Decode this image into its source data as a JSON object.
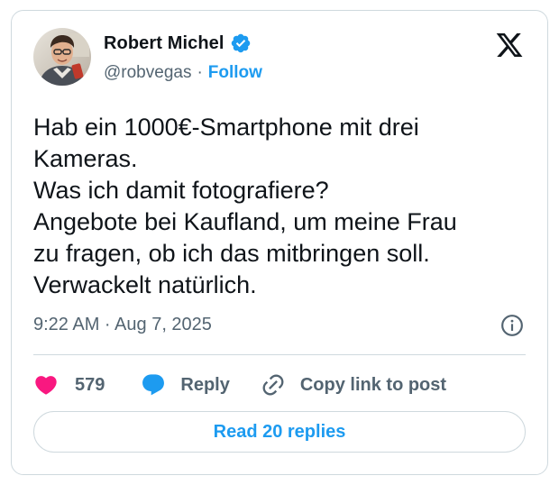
{
  "author": {
    "display_name": "Robert Michel",
    "handle": "@robvegas",
    "separator": "·",
    "follow_label": "Follow",
    "verified_icon": "verified-badge-icon"
  },
  "tweet": {
    "lines": [
      "Hab ein 1000€-Smartphone mit drei",
      "Kameras.",
      "Was ich damit fotografiere?",
      "Angebote bei Kaufland, um meine Frau",
      "zu fragen, ob ich das mitbringen soll.",
      "Verwackelt natürlich."
    ],
    "timestamp": "9:22 AM · Aug 7, 2025"
  },
  "actions": {
    "like_count": "579",
    "reply_label": "Reply",
    "copy_label": "Copy link to post"
  },
  "footer": {
    "read_replies_label": "Read 20 replies"
  },
  "colors": {
    "accent": "#1d9bf0",
    "like": "#f91880",
    "text": "#0f1419",
    "muted": "#536471",
    "border": "#cfd9de"
  }
}
